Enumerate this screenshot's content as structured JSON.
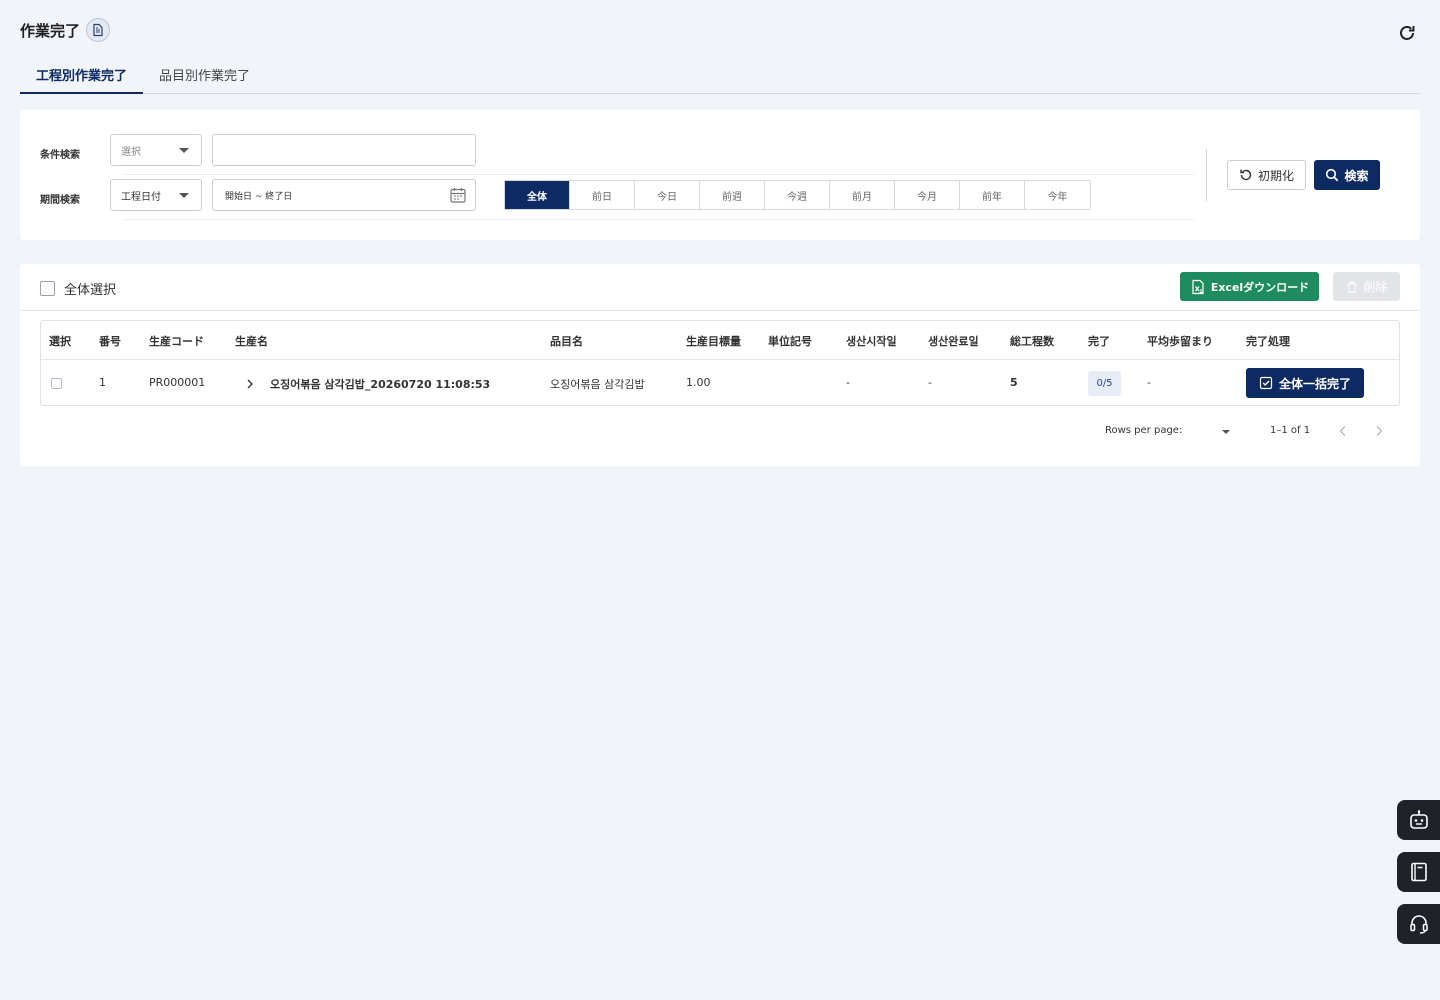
{
  "header": {
    "title": "作業完了"
  },
  "tabs": [
    {
      "label": "工程別作業完了",
      "active": true
    },
    {
      "label": "品目別作業完了",
      "active": false
    }
  ],
  "filters": {
    "condition_label": "条件検索",
    "condition_select_placeholder": "選択",
    "condition_text_value": "",
    "period_label": "期間検索",
    "period_select_value": "工程日付",
    "date_range_placeholder": "開始日 ~ 終了日",
    "periods": [
      "全体",
      "前日",
      "今日",
      "前週",
      "今週",
      "前月",
      "今月",
      "前年",
      "今年"
    ],
    "active_period": "全体",
    "reset_label": "初期化",
    "search_label": "検索"
  },
  "table": {
    "select_all_label": "全体選択",
    "excel_label": "Excelダウンロード",
    "delete_label": "削除",
    "columns": [
      "選択",
      "番号",
      "生産コード",
      "生産名",
      "品目名",
      "生産目標量",
      "単位記号",
      "생산시작일",
      "생산완료일",
      "総工程数",
      "完了",
      "平均歩留まり",
      "完了処理"
    ],
    "rows": [
      {
        "number": "1",
        "code": "PR000001",
        "name": "오징어볶음 삼각김밥_20260720 11:08:53",
        "item": "오징어볶음 삼각김밥",
        "target": "1.00",
        "unit": "",
        "start": "-",
        "end": "-",
        "total_steps": "5",
        "done": "0/5",
        "yield": "-",
        "action_label": "全体一括完了"
      }
    ],
    "pagination": {
      "rows_per_page_label": "Rows per page:",
      "rows_per_page_value": "",
      "range": "1–1 of 1"
    }
  },
  "colors": {
    "primary": "#0e2a63",
    "excel": "#1e8c5e",
    "background": "#f1f4f9",
    "side_buttons": "#1f2329"
  },
  "icons": [
    "document-icon",
    "refresh-icon",
    "calendar-icon",
    "reset-icon",
    "search-icon",
    "excel-icon",
    "trash-icon",
    "chevron-right-icon",
    "check-square-icon",
    "chevron-left-icon",
    "robot-icon",
    "book-icon",
    "headset-icon"
  ]
}
